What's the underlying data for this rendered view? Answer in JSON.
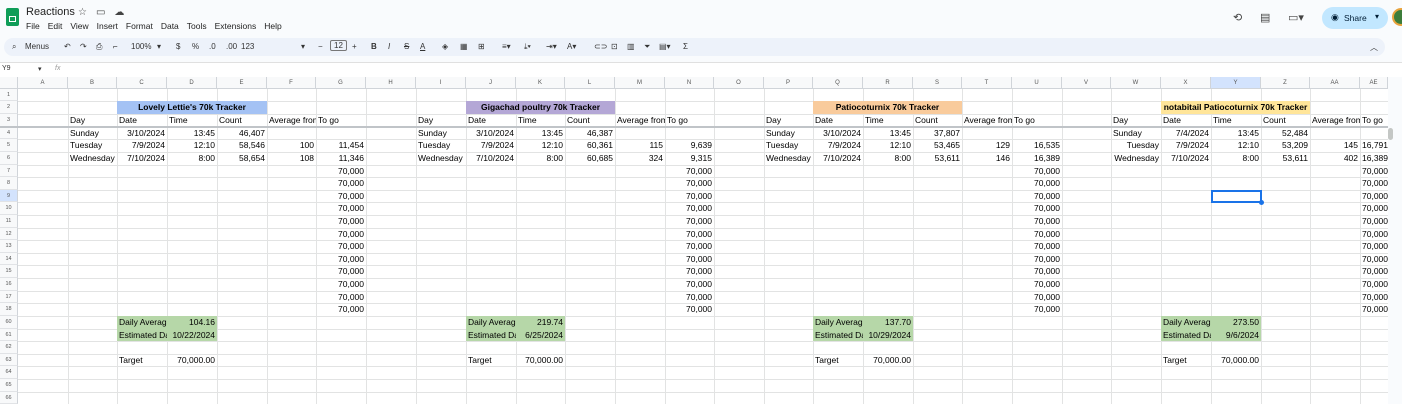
{
  "doc": {
    "title": "Reactions",
    "menus": [
      "File",
      "Edit",
      "View",
      "Insert",
      "Format",
      "Data",
      "Tools",
      "Extensions",
      "Help"
    ],
    "share_label": "Share"
  },
  "toolbar": {
    "menus_label": "Menus",
    "zoom": "100%",
    "currency": "$",
    "percent": "%",
    "dec_less": ".0",
    "dec_more": ".00",
    "format_123": "123",
    "font_size": "12"
  },
  "formula_bar": {
    "name_box": "Y9",
    "fx": "fx"
  },
  "columns": [
    "A",
    "B",
    "C",
    "D",
    "E",
    "F",
    "G",
    "H",
    "I",
    "J",
    "K",
    "L",
    "M",
    "N",
    "O",
    "P",
    "Q",
    "R",
    "S",
    "T",
    "U",
    "V",
    "W",
    "X",
    "Y",
    "Z",
    "AA",
    "AE"
  ],
  "rows": [
    "1",
    "2",
    "3",
    "4",
    "5",
    "6",
    "7",
    "8",
    "9",
    "10",
    "11",
    "12",
    "13",
    "14",
    "15",
    "16",
    "17",
    "18",
    "60",
    "61",
    "62",
    "63",
    "64",
    "65",
    "66"
  ],
  "selected_cell": "Y9",
  "colors": {
    "blue": "#a4c2f4",
    "purple": "#b4a7d6",
    "orange": "#f9cb9c",
    "yellow": "#ffe599",
    "green": "#b6d7a8"
  },
  "trackers": [
    {
      "title": "Lovely Lettie's 70k Tracker",
      "color": "blue",
      "headers": [
        "Day",
        "Date",
        "Time",
        "Count",
        "Average from",
        "To go"
      ],
      "rows": [
        [
          "Sunday",
          "3/10/2024",
          "13:45",
          "46,407",
          "",
          ""
        ],
        [
          "Tuesday",
          "7/9/2024",
          "12:10",
          "58,546",
          "100",
          "11,454"
        ],
        [
          "Wednesday",
          "7/10/2024",
          "8:00",
          "58,654",
          "108",
          "11,346"
        ]
      ],
      "togo_rest": [
        "70,000",
        "70,000",
        "70,000",
        "70,000",
        "70,000",
        "70,000",
        "70,000",
        "70,000",
        "70,000",
        "70,000",
        "70,000",
        "70,000"
      ],
      "daily_avg_label": "Daily Average",
      "daily_avg": "104.16",
      "est_label": "Estimated Date",
      "est": "10/22/2024",
      "target_label": "Target",
      "target": "70,000.00"
    },
    {
      "title": "Gigachad poultry 70k Tracker",
      "color": "purple",
      "headers": [
        "Day",
        "Date",
        "Time",
        "Count",
        "Average from",
        "To go"
      ],
      "rows": [
        [
          "Sunday",
          "3/10/2024",
          "13:45",
          "46,387",
          "",
          ""
        ],
        [
          "Tuesday",
          "7/9/2024",
          "12:10",
          "60,361",
          "115",
          "9,639"
        ],
        [
          "Wednesday",
          "7/10/2024",
          "8:00",
          "60,685",
          "324",
          "9,315"
        ]
      ],
      "togo_rest": [
        "70,000",
        "70,000",
        "70,000",
        "70,000",
        "70,000",
        "70,000",
        "70,000",
        "70,000",
        "70,000",
        "70,000",
        "70,000",
        "70,000"
      ],
      "daily_avg_label": "Daily Average",
      "daily_avg": "219.74",
      "est_label": "Estimated Date",
      "est": "6/25/2024",
      "target_label": "Target",
      "target": "70,000.00"
    },
    {
      "title": "Patiocoturnix 70k Tracker",
      "color": "orange",
      "headers": [
        "Day",
        "Date",
        "Time",
        "Count",
        "Average from",
        "To go"
      ],
      "rows": [
        [
          "Sunday",
          "3/10/2024",
          "13:45",
          "37,807",
          "",
          ""
        ],
        [
          "Tuesday",
          "7/9/2024",
          "12:10",
          "53,465",
          "129",
          "16,535"
        ],
        [
          "Wednesday",
          "7/10/2024",
          "8:00",
          "53,611",
          "146",
          "16,389"
        ]
      ],
      "togo_rest": [
        "70,000",
        "70,000",
        "70,000",
        "70,000",
        "70,000",
        "70,000",
        "70,000",
        "70,000",
        "70,000",
        "70,000",
        "70,000",
        "70,000"
      ],
      "daily_avg_label": "Daily Average",
      "daily_avg": "137.70",
      "est_label": "Estimated Date",
      "est": "10/29/2024",
      "target_label": "Target",
      "target": "70,000.00"
    },
    {
      "title": "notabitail Patiocoturnix 70k Tracker",
      "color": "yellow",
      "headers": [
        "Day",
        "Date",
        "Time",
        "Count",
        "Average from",
        "To go"
      ],
      "rows": [
        [
          "Sunday",
          "7/4/2024",
          "13:45",
          "52,484",
          "",
          ""
        ],
        [
          "Tuesday",
          "7/9/2024",
          "12:10",
          "53,209",
          "145",
          "16,791"
        ],
        [
          "Wednesday",
          "7/10/2024",
          "8:00",
          "53,611",
          "402",
          "16,389"
        ]
      ],
      "togo_rest": [
        "70,000",
        "70,000",
        "70,000",
        "70,000",
        "70,000",
        "70,000",
        "70,000",
        "70,000",
        "70,000",
        "70,000",
        "70,000",
        "70,000"
      ],
      "daily_avg_label": "Daily Average",
      "daily_avg": "273.50",
      "est_label": "Estimated Date",
      "est": "9/6/2024",
      "target_label": "Target",
      "target": "70,000.00"
    }
  ]
}
